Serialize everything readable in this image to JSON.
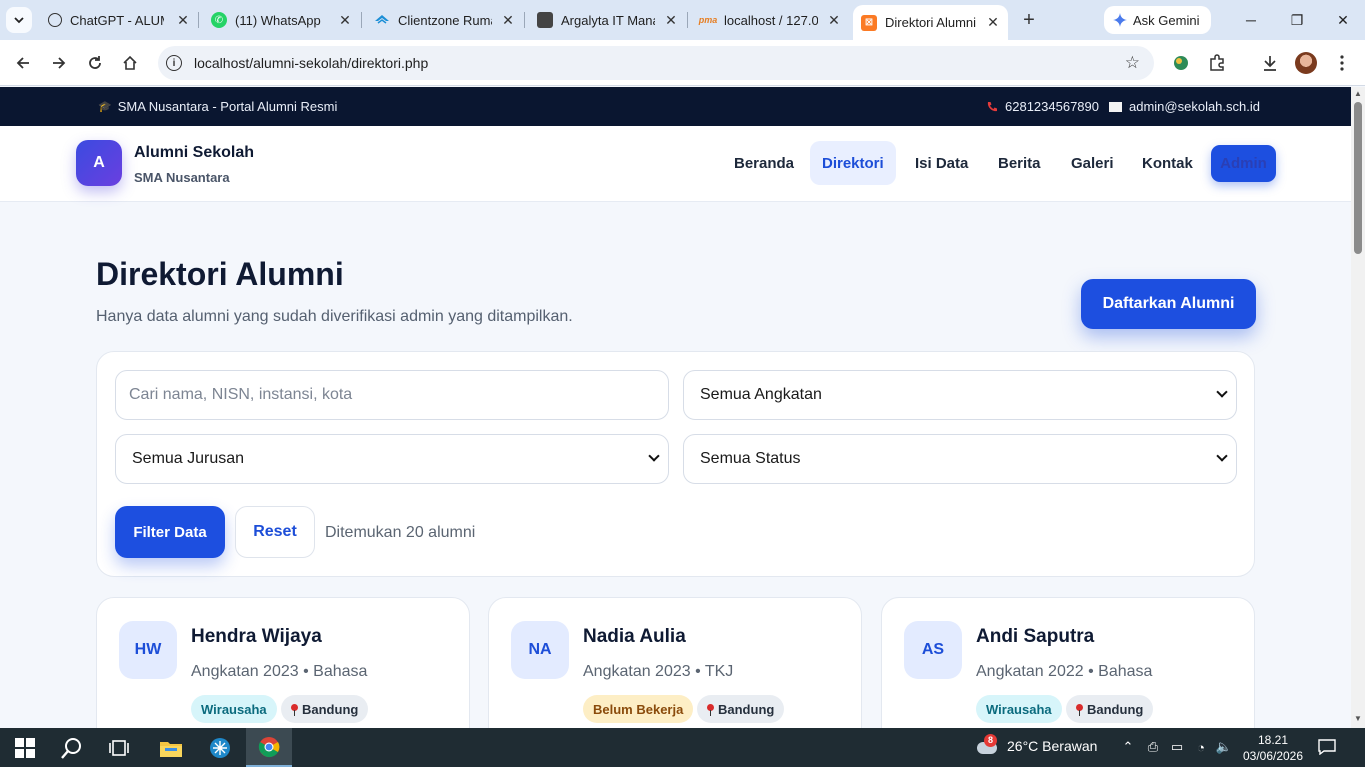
{
  "browser": {
    "tabs": [
      {
        "title": "ChatGPT - ALUMNI",
        "icon": "chatgpt-icon"
      },
      {
        "title": "(11) WhatsApp",
        "icon": "whatsapp-icon"
      },
      {
        "title": "Clientzone Rumah",
        "icon": "clientzone-icon"
      },
      {
        "title": "Argalyta IT Mana",
        "icon": "argalyta-icon"
      },
      {
        "title": "localhost / 127.0.",
        "icon": "phpmyadmin-icon"
      },
      {
        "title": "Direktori Alumni",
        "icon": "xampp-icon",
        "active": true
      }
    ],
    "gemini_label": "Ask Gemini",
    "url": "localhost/alumni-sekolah/direktori.php"
  },
  "topbar": {
    "school": "SMA Nusantara - Portal Alumni Resmi",
    "phone": "6281234567890",
    "email": "admin@sekolah.sch.id"
  },
  "header": {
    "logo_letter": "A",
    "title": "Alumni Sekolah",
    "subtitle": "SMA Nusantara",
    "nav": [
      {
        "label": "Beranda"
      },
      {
        "label": "Direktori",
        "active": true
      },
      {
        "label": "Isi Data"
      },
      {
        "label": "Berita"
      },
      {
        "label": "Galeri"
      },
      {
        "label": "Kontak"
      }
    ],
    "admin_label": "Admin"
  },
  "main": {
    "title": "Direktori Alumni",
    "subtitle": "Hanya data alumni yang sudah diverifikasi admin yang ditampilkan.",
    "register_button": "Daftarkan Alumni"
  },
  "filters": {
    "search_placeholder": "Cari nama, NISN, instansi, kota",
    "angkatan": "Semua Angkatan",
    "jurusan": "Semua Jurusan",
    "status": "Semua Status",
    "filter_button": "Filter Data",
    "reset_button": "Reset",
    "result_text": "Ditemukan 20 alumni"
  },
  "alumni": [
    {
      "initials": "HW",
      "name": "Hendra Wijaya",
      "meta": "Angkatan 2023 • Bahasa",
      "status": "Wirausaha",
      "status_color": "#d7f5fa",
      "city": "Bandung"
    },
    {
      "initials": "NA",
      "name": "Nadia Aulia",
      "meta": "Angkatan 2023 • TKJ",
      "status": "Belum Bekerja",
      "status_color": "#fdeec5",
      "city": "Bandung"
    },
    {
      "initials": "AS",
      "name": "Andi Saputra",
      "meta": "Angkatan 2022 • Bahasa",
      "status": "Wirausaha",
      "status_color": "#d7f5fa",
      "city": "Bandung"
    }
  ],
  "taskbar": {
    "weather": "26°C  Berawan",
    "notification_count": "8",
    "time": "18.21",
    "date": "03/06/2026"
  },
  "colors": {
    "primary": "#1d4fe0",
    "topstrip": "#0a1630",
    "page_bg": "#f4f7fc"
  }
}
